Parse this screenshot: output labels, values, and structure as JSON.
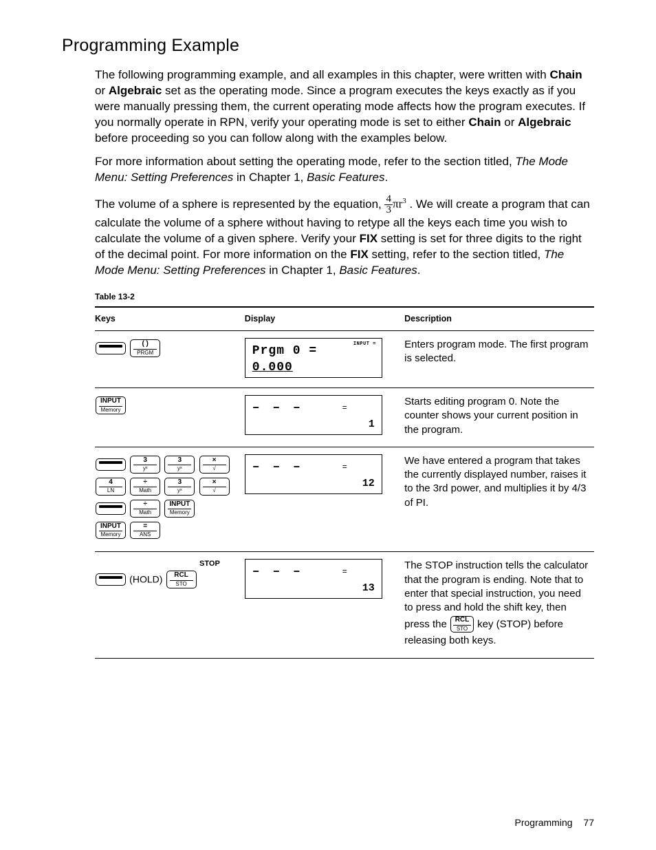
{
  "heading": "Programming Example",
  "para1_a": "The following programming example, and all examples in this chapter, were written with ",
  "para1_b1": "Chain",
  "para1_c": " or ",
  "para1_b2": "Algebraic",
  "para1_d": " set as the operating mode. Since a program executes the keys exactly as if you were manually pressing them, the current operating mode affects how the program executes. If you normally operate in RPN, verify your operating mode is set to either ",
  "para1_b3": "Chain",
  "para1_e": " or ",
  "para1_b4": "Algebraic",
  "para1_f": " before proceeding so you can follow along with the examples below.",
  "para2_a": "For more information about setting the operating mode, refer to the section titled, ",
  "para2_i1": "The Mode Menu: Setting Preferences",
  "para2_b": " in Chapter 1, ",
  "para2_i2": "Basic Features",
  "para2_c": ".",
  "para3_a": "The volume of a sphere is represented by the equation, ",
  "frac_n": "4",
  "frac_d": "3",
  "eq_tail": "πr³",
  "para3_b": " . We will create a program that can calculate the volume of a sphere without having to retype all the keys each time you wish to calculate the volume of a given sphere. Verify your ",
  "para3_fix1": "FIX",
  "para3_c": " setting is set for three digits to the right of the decimal point. For more information on the ",
  "para3_fix2": "FIX",
  "para3_d": " setting, refer to the section titled, ",
  "para3_i1": "The Mode Menu: Setting Preferences",
  "para3_e": " in Chapter 1, ",
  "para3_i2": "Basic Features",
  "para3_f": ".",
  "table_caption": "Table 13-2",
  "th_keys": "Keys",
  "th_display": "Display",
  "th_desc": "Description",
  "rows": {
    "r1": {
      "key_prgm_top": "( )",
      "key_prgm_bot": "PRGM",
      "lcd_annun": "INPUT  =",
      "lcd_line1": "Prgm   0   =",
      "lcd_line2": "0.000",
      "desc": "Enters program mode. The first program is selected."
    },
    "r2": {
      "key_input_top": "INPUT",
      "key_input_bot": "Memory",
      "lcd_eq": "=",
      "lcd_dashes": "– – –",
      "lcd_count": "1",
      "desc": "Starts editing program 0. Note the counter shows your current position in the program."
    },
    "r3": {
      "keys": {
        "k1_top": "3",
        "k1_bot": "yˣ",
        "k2_top": "3",
        "k2_bot": "yˣ",
        "k3_top": "×",
        "k3_bot": "√",
        "k4_top": "4",
        "k4_bot": "LN",
        "k5_top": "÷",
        "k5_bot": "Math",
        "k6_top": "3",
        "k6_bot": "yˣ",
        "k7_top": "×",
        "k7_bot": "√",
        "k8_top": "÷",
        "k8_bot": "Math",
        "k9_top": "INPUT",
        "k9_bot": "Memory",
        "k10_top": "INPUT",
        "k10_bot": "Memory",
        "k11_top": "=",
        "k11_bot": "ANS"
      },
      "lcd_eq": "=",
      "lcd_dashes": "– – –",
      "lcd_count": "12",
      "desc": "We have entered a program that takes the currently displayed number, raises it to the 3rd power, and multiplies it by 4/3 of PI."
    },
    "r4": {
      "stop": "STOP",
      "hold": "(HOLD)",
      "key_rcl_top": "RCL",
      "key_rcl_bot": "STO",
      "lcd_eq": "=",
      "lcd_dashes": "– – –",
      "lcd_count": "13",
      "desc_a": "The STOP instruction tells the calculator that the program is ending. Note that to enter that special instruction, you need to press and hold the shift key, then press the ",
      "desc_b": " key (STOP) before releasing both keys.",
      "inline_rcl_top": "RCL",
      "inline_rcl_bot": "STO"
    }
  },
  "footer_label": "Programming",
  "footer_page": "77"
}
